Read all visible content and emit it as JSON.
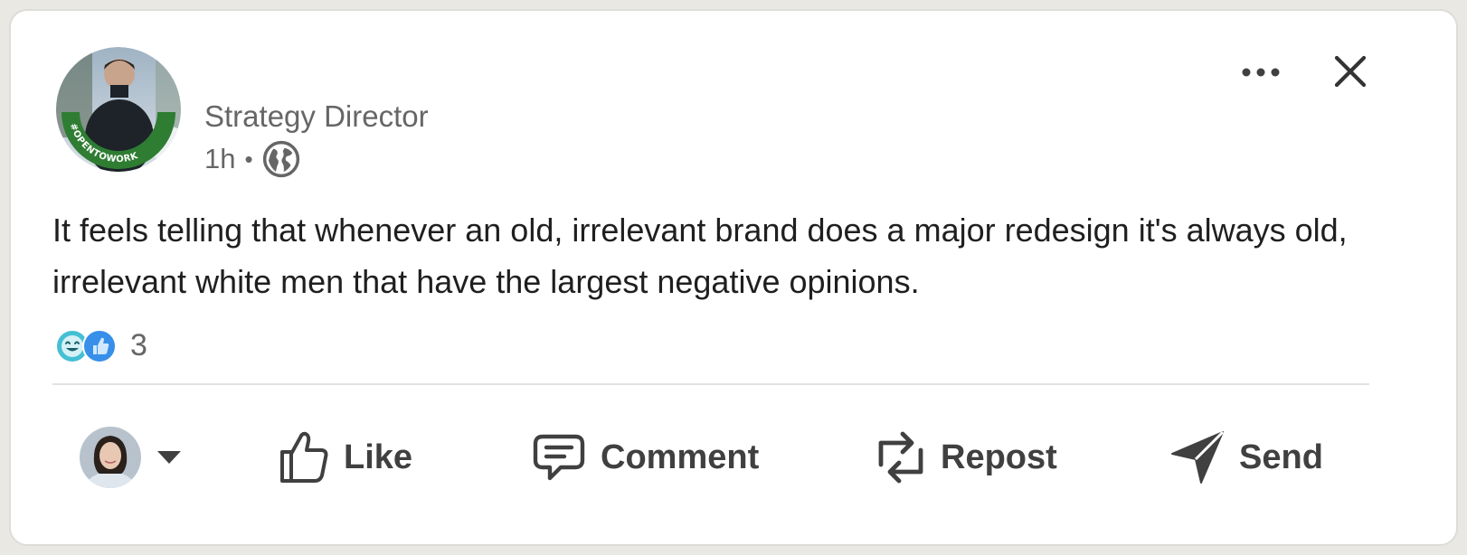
{
  "post": {
    "author_title": "Strategy Director",
    "time": "1h",
    "separator": "•",
    "visibility_icon": "globe-icon",
    "avatar_badge": "#OPENTOWORK",
    "text": "It feels telling that whenever an old, irrelevant brand does a major redesign it's always old, irrelevant white men that have the largest negative opinions.",
    "reactions": {
      "icons": [
        "insightful-icon",
        "like-icon"
      ],
      "count": "3"
    }
  },
  "header_controls": {
    "more_icon": "ellipsis-icon",
    "close_icon": "close-icon"
  },
  "actions": [
    {
      "label": "Like",
      "icon": "thumbs-up-icon"
    },
    {
      "label": "Comment",
      "icon": "comment-icon"
    },
    {
      "label": "Repost",
      "icon": "repost-icon"
    },
    {
      "label": "Send",
      "icon": "send-icon"
    }
  ],
  "colors": {
    "open_to_work_ring": "#2e7d32",
    "like_blue": "#378fe9",
    "insightful_teal": "#44bfd3",
    "text_primary": "#1f1f1f",
    "text_secondary": "#666666"
  }
}
